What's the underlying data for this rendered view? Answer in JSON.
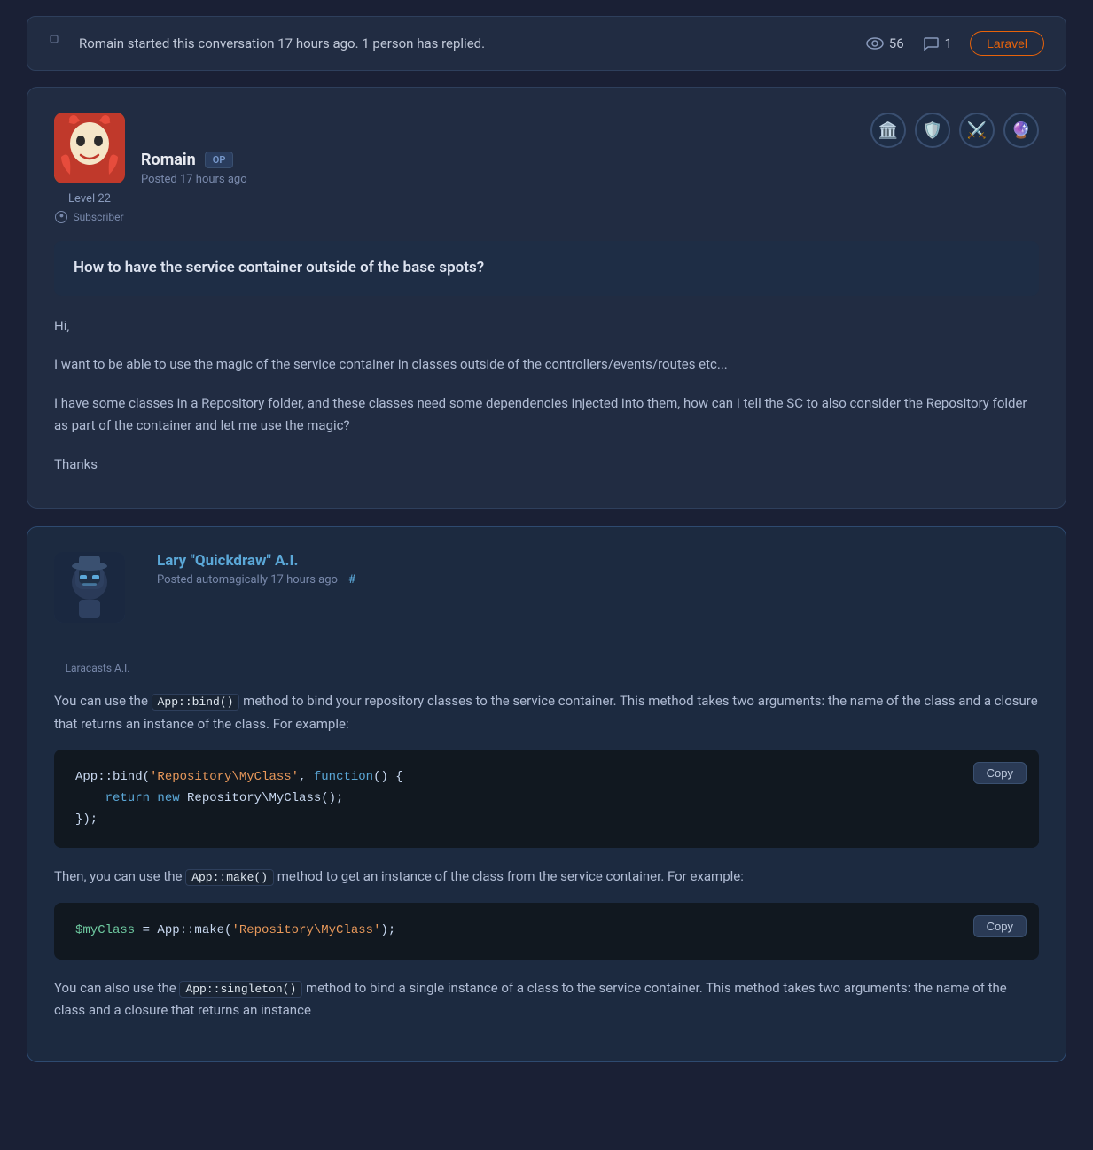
{
  "infoBar": {
    "text": "Romain started this conversation 17 hours ago. 1 person has replied.",
    "views": "56",
    "replies": "1",
    "tag": "Laravel"
  },
  "post": {
    "author": {
      "name": "Romain",
      "badge": "OP",
      "level": "Level 22",
      "subscriber": "Subscriber",
      "time": "Posted 17 hours ago",
      "avatarEmoji": "🃏"
    },
    "question": "How to have the service container outside of the base spots?",
    "body": [
      "Hi,",
      "I want to be able to use the magic of the service container in classes outside of the controllers/events/routes etc...",
      "I have some classes in a Repository folder, and these classes need some dependencies injected into them, how can I tell the SC to also consider the Repository folder as part of the container and let me use the magic?",
      "Thanks"
    ],
    "badges": [
      "🏛️",
      "🛡️",
      "⚔️",
      "🔮"
    ]
  },
  "aiReply": {
    "author": {
      "name": "Lary \"Quickdraw\" A.I.",
      "label": "Laracasts A.I.",
      "time": "Posted automagically 17 hours ago",
      "avatarEmoji": "🤖"
    },
    "bodyParts": [
      {
        "type": "text-with-code",
        "text": "You can use the ",
        "code": "App::bind()",
        "text2": " method to bind your repository classes to the service container. This method takes two arguments: the name of the class and a closure that returns an instance of the class. For example:"
      }
    ],
    "codeBlocks": [
      {
        "id": "code1",
        "copyLabel": "Copy",
        "lines": [
          {
            "parts": [
              {
                "type": "white",
                "text": "App::bind("
              },
              {
                "type": "string",
                "text": "'Repository\\MyClass'"
              },
              {
                "type": "white",
                "text": ", "
              },
              {
                "type": "keyword",
                "text": "function"
              },
              {
                "type": "white",
                "text": "() {"
              }
            ]
          },
          {
            "parts": [
              {
                "type": "keyword",
                "text": "    return new"
              },
              {
                "type": "white",
                "text": " Repository\\MyClass();"
              }
            ]
          },
          {
            "parts": [
              {
                "type": "white",
                "text": "});"
              }
            ]
          }
        ]
      }
    ],
    "midText": {
      "before": "Then, you can use the ",
      "code": "App::make()",
      "after": " method to get an instance of the class from the service container. For example:"
    },
    "codeBlocks2": [
      {
        "id": "code2",
        "copyLabel": "Copy",
        "lines": [
          {
            "parts": [
              {
                "type": "var",
                "text": "$myClass"
              },
              {
                "type": "white",
                "text": " = App::make("
              },
              {
                "type": "string",
                "text": "'Repository\\MyClass'"
              },
              {
                "type": "white",
                "text": ");"
              }
            ]
          }
        ]
      }
    ],
    "bottomText": {
      "before": "You can also use the ",
      "code": "App::singleton()",
      "after": " method to bind a single instance of a class to the service container. This method takes two arguments: the name of the class and a closure that returns an instance"
    }
  }
}
